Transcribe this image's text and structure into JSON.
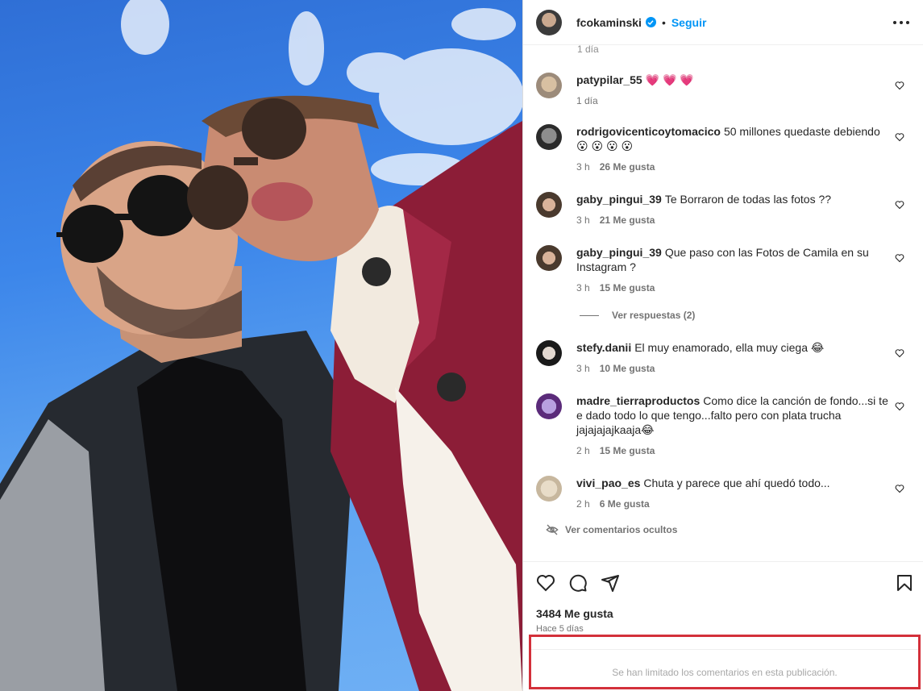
{
  "post": {
    "author": "fcokaminski",
    "follow_label": "Seguir",
    "separator": "•",
    "likes_text": "3484 Me gusta",
    "posted_ago": "Hace 5 días",
    "comments_limited_text": "Se han limitado los comentarios en esta publicación."
  },
  "partial_comment": {
    "time": "1 día"
  },
  "comments": [
    {
      "user": "patypilar_55",
      "text": "💗 💗 💗",
      "time": "1 día",
      "likes": ""
    },
    {
      "user": "rodrigovicenticoytomacico",
      "text": "50 millones quedaste debiendo 😮 😮 😮 😮",
      "time": "3 h",
      "likes": "26 Me gusta"
    },
    {
      "user": "gaby_pingui_39",
      "text": "Te Borraron de todas las fotos ??",
      "time": "3 h",
      "likes": "21 Me gusta"
    },
    {
      "user": "gaby_pingui_39",
      "text": "Que paso con las Fotos de Camila en su Instagram ?",
      "time": "3 h",
      "likes": "15 Me gusta"
    },
    {
      "user": "stefy.danii",
      "text": "El muy enamorado, ella muy ciega 😂",
      "time": "3 h",
      "likes": "10 Me gusta"
    },
    {
      "user": "madre_tierraproductos",
      "text": "Como dice la canción de fondo...si te e dado todo lo que tengo...falto pero con plata trucha jajajajajkaaja😂",
      "time": "2 h",
      "likes": "15 Me gusta"
    },
    {
      "user": "vivi_pao_es",
      "text": "Chuta y parece que ahí quedó todo...",
      "time": "2 h",
      "likes": "6 Me gusta"
    }
  ],
  "view_replies_label": "Ver respuestas (2)",
  "hidden_comments_label": "Ver comentarios ocultos",
  "colors": {
    "link": "#0095f6",
    "secondary_text": "#737373",
    "highlight_border": "#d3303a"
  },
  "icons": [
    "heart-icon",
    "comment-icon",
    "share-icon",
    "bookmark-icon",
    "eye-off-icon",
    "more-icon",
    "verified-icon"
  ]
}
